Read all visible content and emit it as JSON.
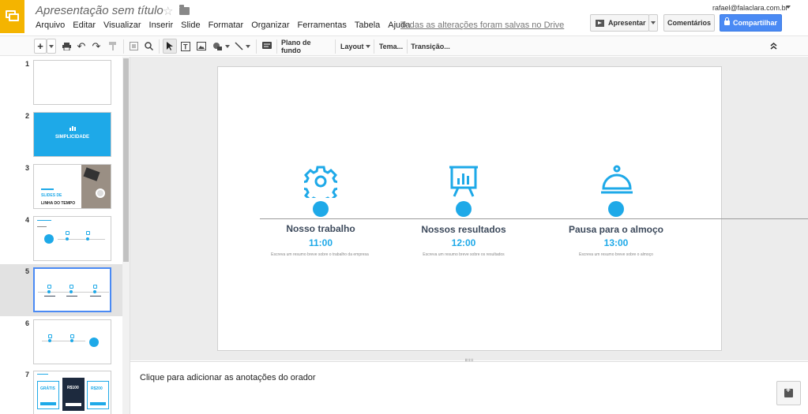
{
  "header": {
    "doc_title": "Apresentação sem título",
    "menu": [
      "Arquivo",
      "Editar",
      "Visualizar",
      "Inserir",
      "Slide",
      "Formatar",
      "Organizar",
      "Ferramentas",
      "Tabela",
      "Ajuda"
    ],
    "save_status": "Todas as alterações foram salvas no Drive",
    "account": "rafael@falaclara.com.br",
    "present_label": "Apresentar",
    "comments_label": "Comentários",
    "share_label": "Compartilhar"
  },
  "toolbar": {
    "background_label": "Plano de fundo",
    "layout_label": "Layout",
    "theme_label": "Tema...",
    "transition_label": "Transição..."
  },
  "filmstrip": {
    "slides": [
      {
        "number": "1"
      },
      {
        "number": "2",
        "title": "SIMPLICIDADE"
      },
      {
        "number": "3",
        "title_line1": "SLIDES DE",
        "title_line2": "LINHA DO TEMPO"
      },
      {
        "number": "4"
      },
      {
        "number": "5"
      },
      {
        "number": "6"
      },
      {
        "number": "7",
        "prices": [
          "GRÁTIS",
          "R$100",
          "R$200"
        ]
      }
    ],
    "selected_index": 4
  },
  "slide": {
    "events": [
      {
        "title": "Nosso trabalho",
        "time": "11:00",
        "desc": "Escreva um resumo breve sobre o trabalho da empresa",
        "icon": "gear-icon"
      },
      {
        "title": "Nossos resultados",
        "time": "12:00",
        "desc": "Escreva um resumo breve sobre os resultados",
        "icon": "presentation-chart-icon"
      },
      {
        "title": "Pausa para o almoço",
        "time": "13:00",
        "desc": "Escreva um resumo breve sobre o almoço",
        "icon": "food-cloche-icon"
      }
    ]
  },
  "notes": {
    "placeholder": "Clique para adicionar as anotações do orador"
  },
  "colors": {
    "accent": "#1ea9e8",
    "share": "#4a8af4",
    "logo": "#f4b400",
    "title_text": "#3d4a5c"
  }
}
